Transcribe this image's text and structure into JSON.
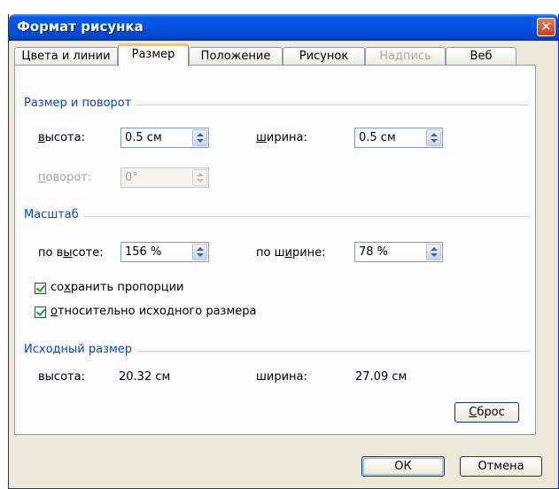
{
  "window": {
    "title": "Формат рисунка",
    "close_glyph": "✕"
  },
  "tabs": [
    {
      "label": "Цвета и линии",
      "state": "normal"
    },
    {
      "label": "Размер",
      "state": "active"
    },
    {
      "label": "Положение",
      "state": "normal"
    },
    {
      "label": "Рисунок",
      "state": "normal"
    },
    {
      "label": "Надпись",
      "state": "disabled"
    },
    {
      "label": "Веб",
      "state": "normal"
    }
  ],
  "size_rotation": {
    "heading": "Размер и поворот",
    "height_label_hot": "в",
    "height_label_rest": "ысота:",
    "height_value": "0.5 см",
    "width_label_hot": "ш",
    "width_label_rest": "ирина:",
    "width_value": "0.5 см",
    "rotation_label_hot": "п",
    "rotation_label_rest": "оворот:",
    "rotation_value": "0°"
  },
  "scale": {
    "heading": "Масштаб",
    "height_label_pre": "по в",
    "height_label_hot": "ы",
    "height_label_post": "соте:",
    "height_value": "156 %",
    "width_label_pre": "по ш",
    "width_label_hot": "и",
    "width_label_post": "рине:",
    "width_value": "78 %",
    "lock_aspect_pre": "со",
    "lock_aspect_hot": "х",
    "lock_aspect_post": "ранить пропорции",
    "lock_aspect_checked": true,
    "relative_hot": "о",
    "relative_post": "тносительно исходного размера",
    "relative_checked": true
  },
  "original_size": {
    "heading": "Исходный размер",
    "height_label": "высота:",
    "height_value": "20.32 см",
    "width_label": "ширина:",
    "width_value": "27.09 см"
  },
  "buttons": {
    "reset_hot": "С",
    "reset_rest": "брос",
    "ok": "ОК",
    "cancel": "Отмена"
  }
}
